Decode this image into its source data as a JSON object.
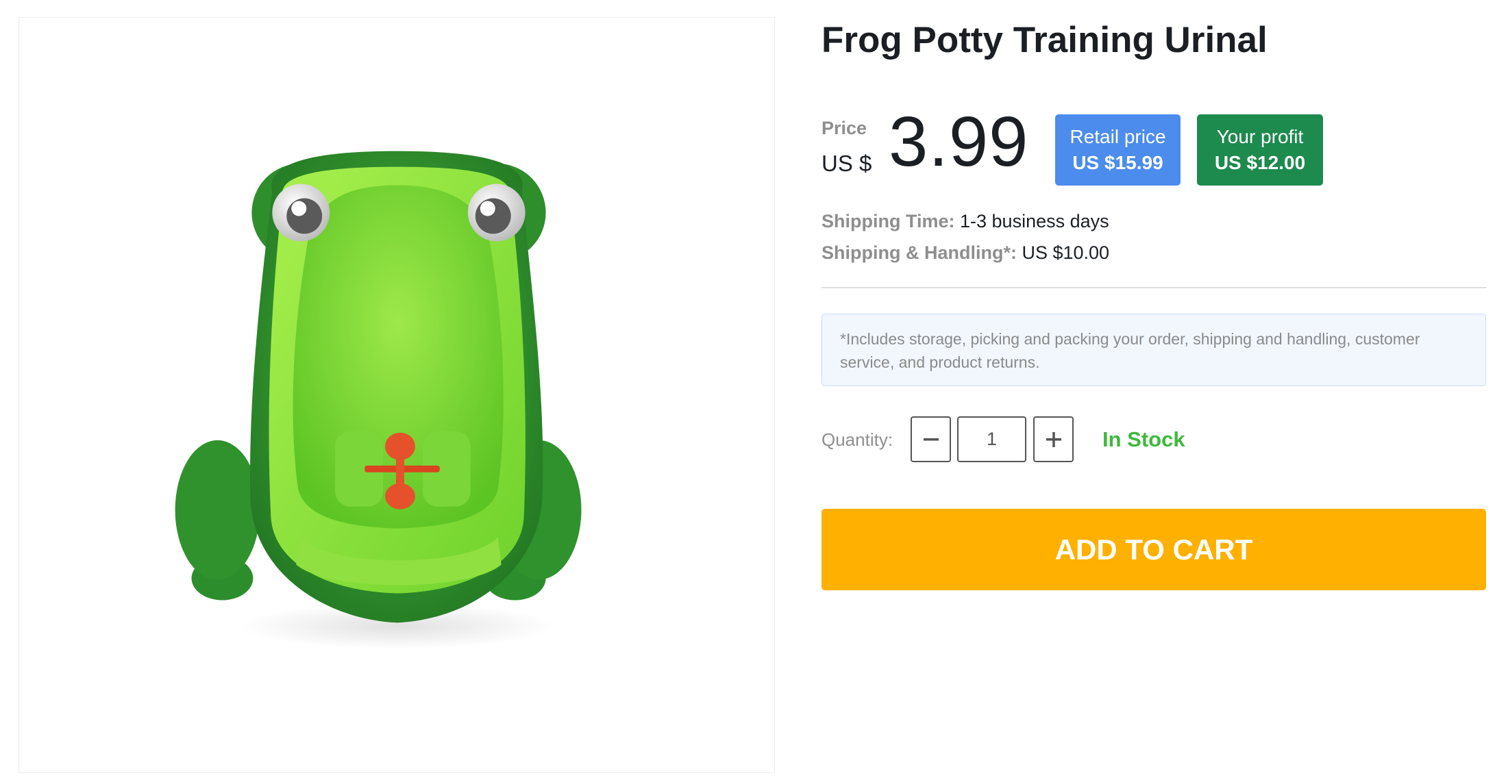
{
  "product": {
    "title": "Frog Potty Training Urinal",
    "image_alt": "Frog Potty Training Urinal"
  },
  "price": {
    "label": "Price",
    "currency": "US $",
    "amount": "3.99"
  },
  "retail": {
    "label": "Retail price",
    "value": "US $15.99",
    "color": "#4c8cec"
  },
  "profit": {
    "label": "Your profit",
    "value": "US $12.00",
    "color": "#1d8a4e"
  },
  "shipping": {
    "time_label": "Shipping Time:",
    "time_value": "1-3 business days",
    "handling_label": "Shipping & Handling*:",
    "handling_value": "US $10.00"
  },
  "note": "*Includes storage, picking and packing your order, shipping and handling, customer service, and product returns.",
  "quantity": {
    "label": "Quantity:",
    "value": "1",
    "minus_icon": "minus-icon",
    "plus_icon": "plus-icon"
  },
  "stock_status": "In Stock",
  "cart_button": "ADD TO CART",
  "colors": {
    "accent_orange": "#ffb000",
    "in_stock_green": "#3db93d"
  }
}
